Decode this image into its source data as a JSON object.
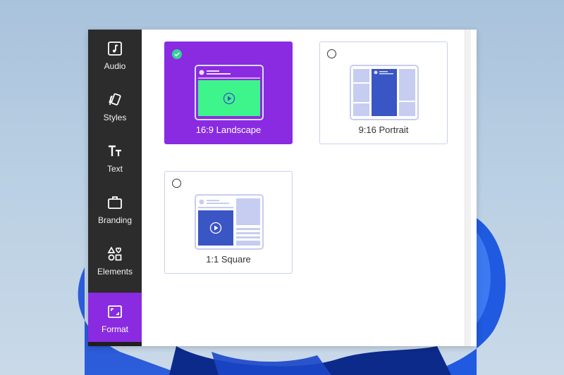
{
  "sidebar": {
    "items": [
      {
        "label": "Audio",
        "icon": "audio-icon",
        "active": false
      },
      {
        "label": "Styles",
        "icon": "styles-icon",
        "active": false
      },
      {
        "label": "Text",
        "icon": "text-icon",
        "active": false
      },
      {
        "label": "Branding",
        "icon": "branding-icon",
        "active": false
      },
      {
        "label": "Elements",
        "icon": "elements-icon",
        "active": false
      },
      {
        "label": "Format",
        "icon": "format-icon",
        "active": true
      }
    ]
  },
  "formats": [
    {
      "label": "16:9 Landscape",
      "selected": true
    },
    {
      "label": "9:16 Portrait",
      "selected": false
    },
    {
      "label": "1:1 Square",
      "selected": false
    }
  ],
  "colors": {
    "accent": "#8a2be2",
    "sidebar_bg": "#2c2c2c",
    "video_green": "#3df58a",
    "video_blue": "#3a55c4",
    "placeholder": "#c7cdf0",
    "check": "#2fd39a"
  }
}
